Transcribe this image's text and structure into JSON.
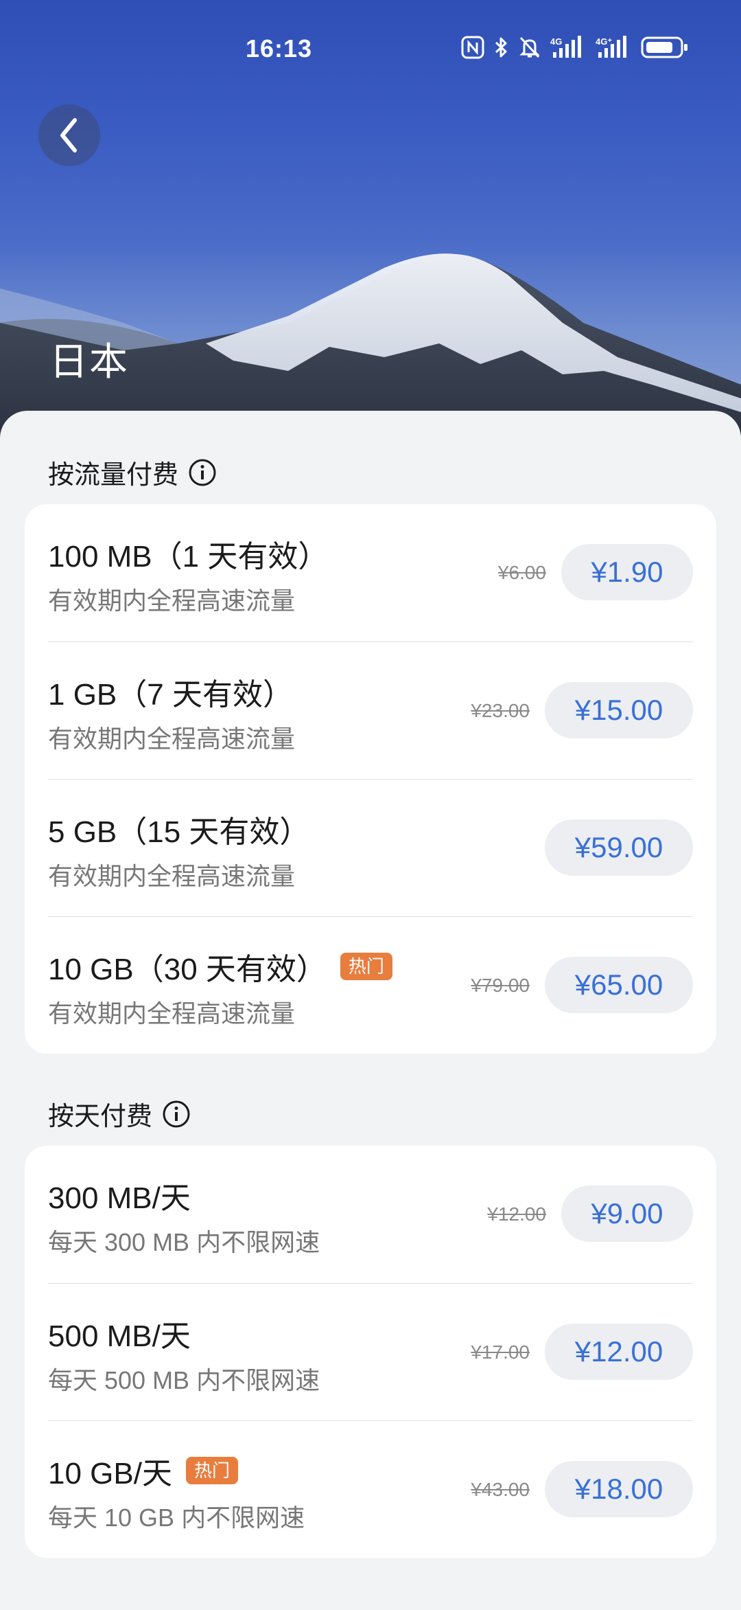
{
  "status_bar": {
    "time": "16:13",
    "icons": [
      "nfc-icon",
      "bluetooth-icon",
      "mute-icon",
      "signal-4g-icon",
      "signal-4g-icon",
      "battery-icon"
    ],
    "signal_label_1": "4G",
    "signal_label_2": "4G⁺"
  },
  "header": {
    "back_icon": "chevron-left-icon",
    "country": "日本"
  },
  "section_traffic": {
    "title": "按流量付费",
    "plans": [
      {
        "name": "100 MB（1 天有效）",
        "desc": "有效期内全程高速流量",
        "old_price": "¥6.00",
        "price": "¥1.90",
        "hot": false
      },
      {
        "name": "1 GB（7 天有效）",
        "desc": "有效期内全程高速流量",
        "old_price": "¥23.00",
        "price": "¥15.00",
        "hot": false
      },
      {
        "name": "5 GB（15 天有效）",
        "desc": "有效期内全程高速流量",
        "old_price": "",
        "price": "¥59.00",
        "hot": false
      },
      {
        "name": "10 GB（30 天有效）",
        "desc": "有效期内全程高速流量",
        "old_price": "¥79.00",
        "price": "¥65.00",
        "hot": true
      }
    ]
  },
  "section_daily": {
    "title": "按天付费",
    "plans": [
      {
        "name": "300 MB/天",
        "desc": "每天 300 MB 内不限网速",
        "old_price": "¥12.00",
        "price": "¥9.00",
        "hot": false
      },
      {
        "name": "500 MB/天",
        "desc": "每天 500 MB 内不限网速",
        "old_price": "¥17.00",
        "price": "¥12.00",
        "hot": false
      },
      {
        "name": "10 GB/天",
        "desc": "每天 10 GB 内不限网速",
        "old_price": "¥43.00",
        "price": "¥18.00",
        "hot": true
      }
    ]
  },
  "hot_label": "热门",
  "colors": {
    "accent": "#3a6fd8",
    "hot_badge": "#e87d3e",
    "sheet_bg": "#f1f3f5"
  }
}
